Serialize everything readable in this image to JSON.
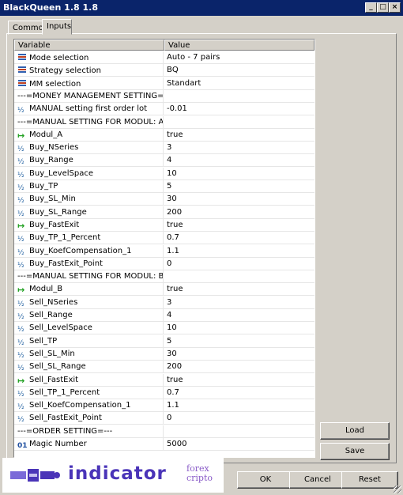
{
  "window": {
    "title": "BlackQueen 1.8 1.8"
  },
  "tabs": [
    {
      "label": "Common",
      "active": false
    },
    {
      "label": "Inputs",
      "active": true
    }
  ],
  "grid": {
    "headers": {
      "variable": "Variable",
      "value": "Value"
    },
    "rows": [
      {
        "icon": "enum-icon",
        "variable": "Mode selection",
        "value": "Auto - 7 pairs"
      },
      {
        "icon": "enum-icon",
        "variable": "Strategy selection",
        "value": "BQ"
      },
      {
        "icon": "enum-icon",
        "variable": "MM selection",
        "value": "Standart"
      },
      {
        "icon": "",
        "variable": "---=MONEY MANAGEMENT SETTING=---",
        "value": ""
      },
      {
        "icon": "double-icon",
        "variable": "MANUAL setting first order lot",
        "value": "-0.01"
      },
      {
        "icon": "",
        "variable": "---=MANUAL SETTING FOR MODUL: A=---",
        "value": ""
      },
      {
        "icon": "bool-icon",
        "variable": "Modul_A",
        "value": "true"
      },
      {
        "icon": "double-icon",
        "variable": "Buy_NSeries",
        "value": "3"
      },
      {
        "icon": "double-icon",
        "variable": "Buy_Range",
        "value": "4"
      },
      {
        "icon": "double-icon",
        "variable": "Buy_LevelSpace",
        "value": "10"
      },
      {
        "icon": "double-icon",
        "variable": "Buy_TP",
        "value": "5"
      },
      {
        "icon": "double-icon",
        "variable": "Buy_SL_Min",
        "value": "30"
      },
      {
        "icon": "double-icon",
        "variable": "Buy_SL_Range",
        "value": "200"
      },
      {
        "icon": "bool-icon",
        "variable": "Buy_FastExit",
        "value": "true"
      },
      {
        "icon": "double-icon",
        "variable": "Buy_TP_1_Percent",
        "value": "0.7"
      },
      {
        "icon": "double-icon",
        "variable": "Buy_KoefCompensation_1",
        "value": "1.1"
      },
      {
        "icon": "double-icon",
        "variable": "Buy_FastExit_Point",
        "value": "0"
      },
      {
        "icon": "",
        "variable": "---=MANUAL SETTING FOR MODUL: B=---",
        "value": ""
      },
      {
        "icon": "bool-icon",
        "variable": "Modul_B",
        "value": "true"
      },
      {
        "icon": "double-icon",
        "variable": "Sell_NSeries",
        "value": "3"
      },
      {
        "icon": "double-icon",
        "variable": "Sell_Range",
        "value": "4"
      },
      {
        "icon": "double-icon",
        "variable": "Sell_LevelSpace",
        "value": "10"
      },
      {
        "icon": "double-icon",
        "variable": "Sell_TP",
        "value": "5"
      },
      {
        "icon": "double-icon",
        "variable": "Sell_SL_Min",
        "value": "30"
      },
      {
        "icon": "double-icon",
        "variable": "Sell_SL_Range",
        "value": "200"
      },
      {
        "icon": "bool-icon",
        "variable": "Sell_FastExit",
        "value": "true"
      },
      {
        "icon": "double-icon",
        "variable": "Sell_TP_1_Percent",
        "value": "0.7"
      },
      {
        "icon": "double-icon",
        "variable": "Sell_KoefCompensation_1",
        "value": "1.1"
      },
      {
        "icon": "double-icon",
        "variable": "Sell_FastExit_Point",
        "value": "0"
      },
      {
        "icon": "",
        "variable": "---=ORDER SETTING=---",
        "value": ""
      },
      {
        "icon": "int-icon",
        "variable": "Magic Number",
        "value": "5000"
      }
    ]
  },
  "side_buttons": {
    "load": "Load",
    "save": "Save"
  },
  "footer_buttons": {
    "ok": "OK",
    "cancel": "Cancel",
    "reset": "Reset"
  },
  "watermark": {
    "main": "indicator",
    "top": "forex",
    "bottom": "cripto"
  },
  "colors": {
    "titlebar": "#0a246a",
    "face": "#d4d0c8",
    "watermark_text": "#4a34b8"
  }
}
